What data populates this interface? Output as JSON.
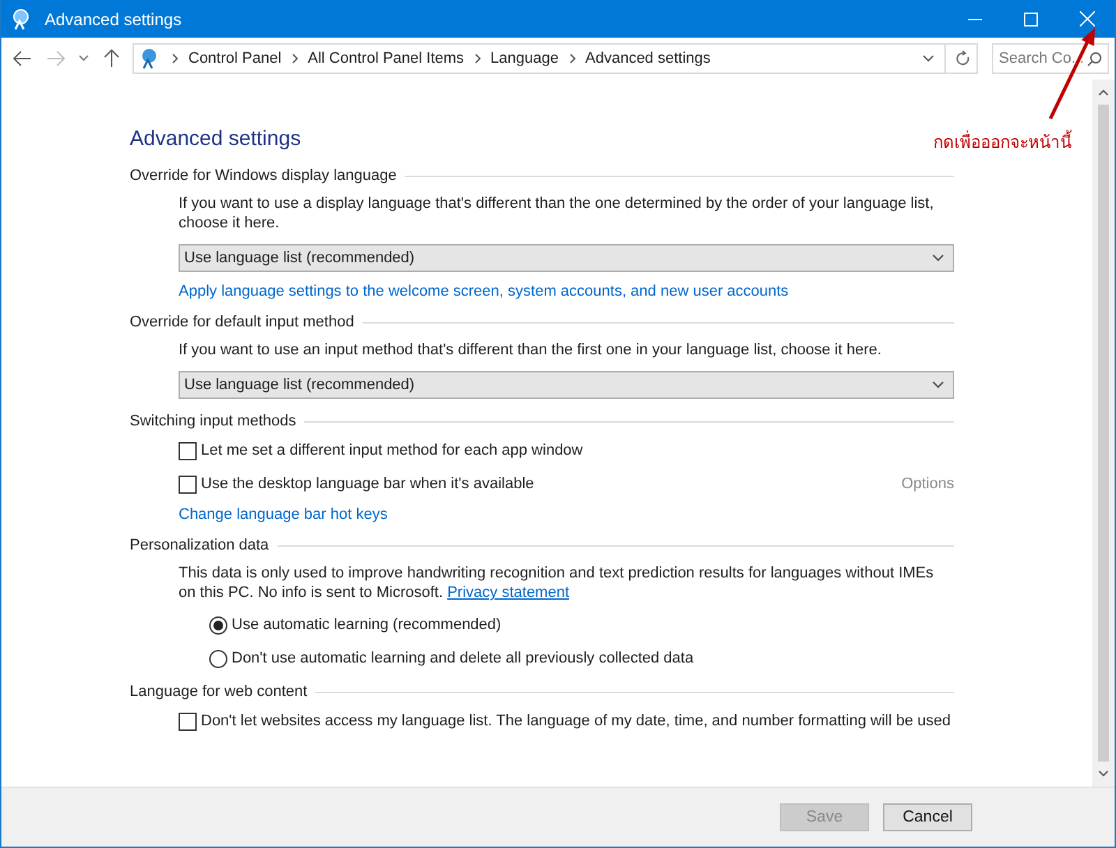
{
  "window": {
    "title": "Advanced settings"
  },
  "address_bar": {
    "path": [
      "Control Panel",
      "All Control Panel Items",
      "Language",
      "Advanced settings"
    ]
  },
  "search": {
    "placeholder": "Search Co..."
  },
  "page_title": "Advanced settings",
  "sections": [
    {
      "heading": "Override for Windows display language",
      "items": [
        {
          "kind": "text",
          "text": "If you want to use a display language that's different than the one determined by the order of your language list, choose it here."
        },
        {
          "kind": "dropdown",
          "value": "Use language list (recommended)"
        },
        {
          "kind": "link",
          "text": "Apply language settings to the welcome screen, system accounts, and new user accounts"
        }
      ]
    },
    {
      "heading": "Override for default input method",
      "items": [
        {
          "kind": "text",
          "text": "If you want to use an input method that's different than the first one in your language list, choose it here."
        },
        {
          "kind": "dropdown",
          "value": "Use language list (recommended)"
        }
      ]
    },
    {
      "heading": "Switching input methods",
      "items": [
        {
          "kind": "checkbox",
          "label": "Let me set a different input method for each app window",
          "checked": false
        },
        {
          "kind": "checkbox",
          "label": "Use the desktop language bar when it's available",
          "checked": false,
          "aside": "Options"
        },
        {
          "kind": "link",
          "text": "Change language bar hot keys"
        }
      ]
    },
    {
      "heading": "Personalization data",
      "items": [
        {
          "kind": "text",
          "text": "This data is only used to improve handwriting recognition and text prediction results for languages without IMEs on this PC. No info is sent to Microsoft.",
          "link": "Privacy statement"
        },
        {
          "kind": "radio",
          "label": "Use automatic learning (recommended)",
          "selected": true
        },
        {
          "kind": "radio",
          "label": "Don't use automatic learning and delete all previously collected data",
          "selected": false
        }
      ]
    },
    {
      "heading": "Language for web content",
      "items": [
        {
          "kind": "checkbox",
          "label": "Don't let websites access my language list. The language of my date, time, and number formatting will be used",
          "checked": false
        }
      ]
    }
  ],
  "annotation": {
    "text": "กดเพื่อออกจะหน้านี้"
  },
  "buttons": [
    {
      "label": "Save",
      "disabled": true
    },
    {
      "label": "Cancel",
      "disabled": false
    }
  ]
}
